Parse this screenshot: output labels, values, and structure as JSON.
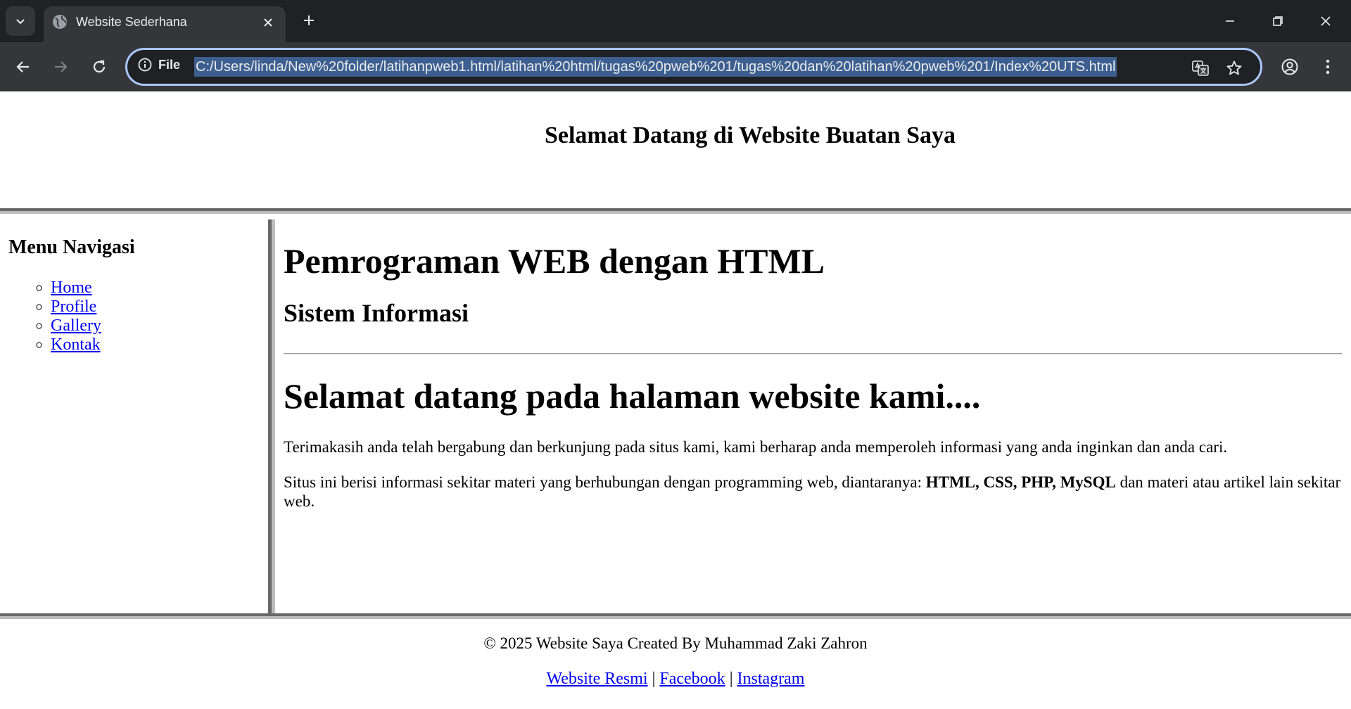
{
  "browser": {
    "tab_title": "Website Sederhana",
    "site_info_label": "File",
    "url": "C:/Users/linda/New%20folder/latihanpweb1.html/latihan%20html/tugas%20pweb%201/tugas%20dan%20latihan%20pweb%201/Index%20UTS.html",
    "colors": {
      "tabstrip": "#202124",
      "toolbar": "#35363a",
      "omnibox_focus_ring": "#a8c7fa",
      "url_selection": "#3d5f8f"
    }
  },
  "header": {
    "title": "Selamat Datang di Website Buatan Saya"
  },
  "sidebar": {
    "title": "Menu Navigasi",
    "items": [
      {
        "label": "Home"
      },
      {
        "label": "Profile"
      },
      {
        "label": "Gallery"
      },
      {
        "label": "Kontak"
      }
    ]
  },
  "main": {
    "heading": "Pemrograman WEB dengan HTML",
    "subheading": "Sistem Informasi",
    "welcome_heading": "Selamat datang pada halaman website kami....",
    "paragraph1": "Terimakasih anda telah bergabung dan berkunjung pada situs kami, kami berharap anda memperoleh informasi yang anda inginkan dan anda cari.",
    "paragraph2_prefix": "Situs ini berisi informasi sekitar materi yang berhubungan dengan programming web, diantaranya: ",
    "paragraph2_bold": "HTML, CSS, PHP, MySQL",
    "paragraph2_suffix": " dan materi atau artikel lain sekitar web."
  },
  "footer": {
    "copyright": "© 2025 Website Saya Created By Muhammad Zaki Zahron",
    "links": [
      {
        "label": "Website Resmi"
      },
      {
        "label": "Facebook"
      },
      {
        "label": "Instagram"
      }
    ],
    "separator": "|"
  },
  "icons": {
    "tab_search": "chevron-down-icon",
    "favicon": "globe-icon",
    "tab_close": "close-icon",
    "new_tab": "plus-icon",
    "minimize": "minimize-icon",
    "restore": "restore-icon",
    "close_window": "close-icon",
    "back": "arrow-left-icon",
    "forward": "arrow-right-icon",
    "reload": "reload-icon",
    "site_info": "info-icon",
    "translate": "translate-icon",
    "bookmark": "star-icon",
    "profile": "account-icon",
    "menu": "more-vert-icon"
  }
}
